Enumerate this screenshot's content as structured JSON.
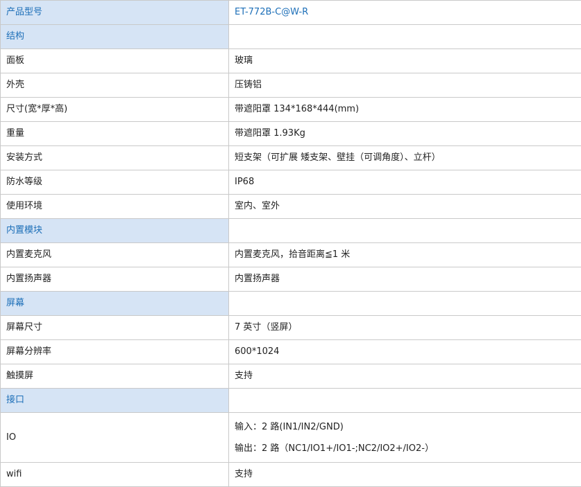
{
  "header": {
    "key": "产品型号",
    "value": "ET-772B-C@W-R"
  },
  "sections": {
    "structure": "结构",
    "module": "内置模块",
    "screen": "屏幕",
    "interface": "接口"
  },
  "structure": {
    "panel": {
      "key": "面板",
      "value": "玻璃"
    },
    "shell": {
      "key": "外壳",
      "value": "压铸铝"
    },
    "size": {
      "key": "尺寸(宽*厚*高)",
      "value": "带遮阳罩 134*168*444(mm)"
    },
    "weight": {
      "key": "重量",
      "value": "带遮阳罩 1.93Kg"
    },
    "mount": {
      "key": "安装方式",
      "value": "短支架（可扩展 矮支架、壁挂（可调角度）、立杆）"
    },
    "ip": {
      "key": "防水等级",
      "value": "IP68"
    },
    "env": {
      "key": "使用环境",
      "value": "室内、室外"
    }
  },
  "module": {
    "mic": {
      "key": "内置麦克风",
      "value": "内置麦克风，拾音距离≦1 米"
    },
    "speaker": {
      "key": "内置扬声器",
      "value": "内置扬声器"
    }
  },
  "screen": {
    "size": {
      "key": "屏幕尺寸",
      "value": "7 英寸（竖屏）"
    },
    "resolution": {
      "key": "屏幕分辨率",
      "value": "600*1024"
    },
    "touch": {
      "key": "触摸屏",
      "value": "支持"
    }
  },
  "interface": {
    "io": {
      "key": "IO",
      "input": "输入：2 路(IN1/IN2/GND)",
      "output": "输出：2 路（NC1/IO1+/IO1-;NC2/IO2+/IO2-）"
    },
    "wifi": {
      "key": "wifi",
      "value": "支持"
    }
  }
}
